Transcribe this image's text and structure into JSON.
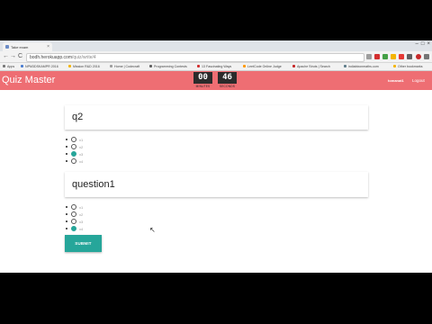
{
  "browser": {
    "tab_title": "Take exam",
    "tab_close": "×",
    "window_controls": [
      "–",
      "□",
      "×"
    ],
    "back": "←",
    "forward": "→",
    "reload": "C",
    "url_host": "bodh.herokuapp.com",
    "url_path": "/quiz/write/4",
    "bookmarks": [
      {
        "label": "Apps",
        "color": "#777777"
      },
      {
        "label": "NPM3DSKAMPR 2016",
        "color": "#4a7bd0"
      },
      {
        "label": "Mission R&D 2016",
        "color": "#f4b400"
      },
      {
        "label": "Home | Codecraft",
        "color": "#9e9e9e"
      },
      {
        "label": "Programming Contests",
        "color": "#616161"
      },
      {
        "label": "13 Fascinating Ways",
        "color": "#d32f2f"
      },
      {
        "label": "LeetCode Online Judge",
        "color": "#ff9800"
      },
      {
        "label": "Apache Struts | Search",
        "color": "#c62828"
      },
      {
        "label": "indiabixonmaths.com",
        "color": "#607d8b"
      },
      {
        "label": "Other bookmarks",
        "color": "#f4b400"
      }
    ]
  },
  "app": {
    "brand": "Quiz Master",
    "timer": {
      "minutes": "00",
      "seconds": "46",
      "minutes_label": "MINUTES",
      "seconds_label": "SECONDS"
    },
    "user": "tomanat1",
    "logout": "Logout"
  },
  "questions": [
    {
      "title": "q2",
      "options": [
        "x1",
        "x2",
        "x3",
        "x4"
      ],
      "selected": 2
    },
    {
      "title": "question1",
      "options": [
        "x1",
        "x2",
        "x3",
        "x4"
      ],
      "selected": 3
    }
  ],
  "submit_label": "SUBMIT",
  "colors": {
    "header": "#ee6e73",
    "accent": "#26a69a"
  }
}
